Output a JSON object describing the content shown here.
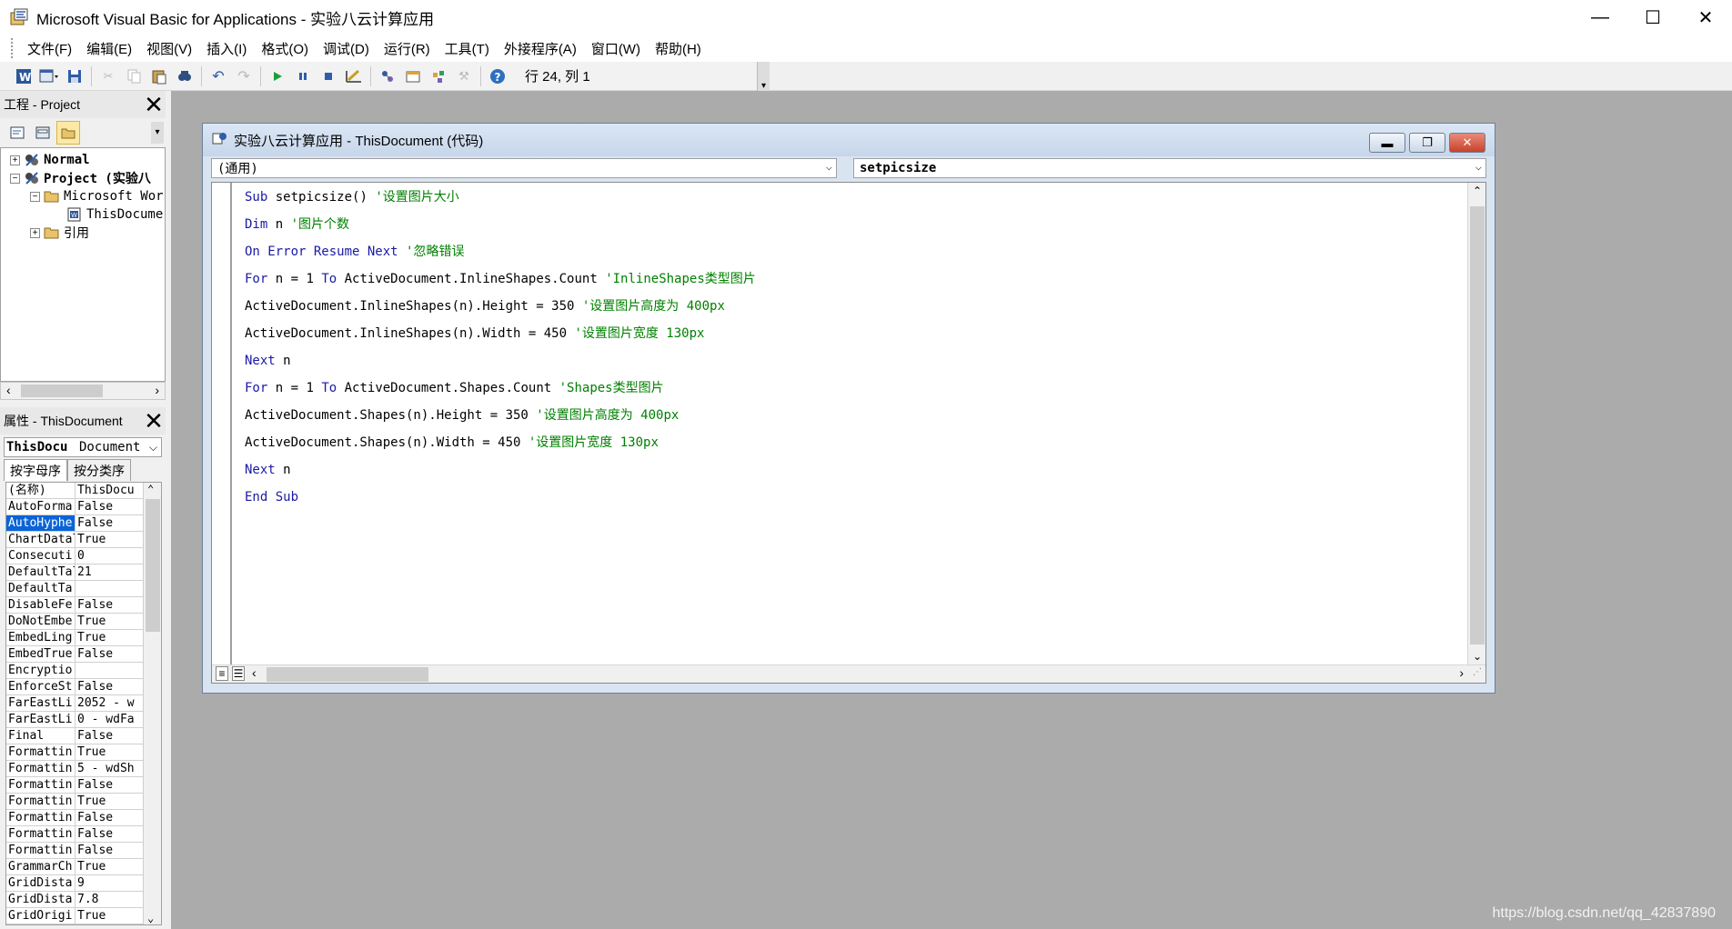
{
  "window": {
    "title": "Microsoft Visual Basic for Applications - 实验八云计算应用",
    "minimize": "—",
    "maximize": "☐",
    "close": "✕"
  },
  "menu": [
    "文件(F)",
    "编辑(E)",
    "视图(V)",
    "插入(I)",
    "格式(O)",
    "调试(D)",
    "运行(R)",
    "工具(T)",
    "外接程序(A)",
    "窗口(W)",
    "帮助(H)"
  ],
  "toolbar": {
    "position": "行 24, 列 1",
    "buttons": [
      "view-word-icon",
      "insert-userform-icon",
      "save-icon",
      "cut-icon",
      "copy-icon",
      "paste-icon",
      "find-icon",
      "undo-icon",
      "redo-icon",
      "run-icon",
      "break-icon",
      "reset-icon",
      "design-mode-icon",
      "project-explorer-icon",
      "properties-icon",
      "object-browser-icon",
      "toolbox-icon",
      "help-icon"
    ]
  },
  "project_pane": {
    "title": "工程 - Project",
    "tree": [
      {
        "label": "Normal",
        "indent": 0,
        "expander": "+",
        "icon": "vba-project-icon"
      },
      {
        "label": "Project (实验八",
        "indent": 0,
        "expander": "−",
        "icon": "vba-project-icon"
      },
      {
        "label": "Microsoft Wor",
        "indent": 1,
        "expander": "−",
        "icon": "folder-open-icon"
      },
      {
        "label": "ThisDocume",
        "indent": 2,
        "expander": "",
        "icon": "word-document-icon"
      },
      {
        "label": "引用",
        "indent": 1,
        "expander": "+",
        "icon": "folder-icon"
      }
    ]
  },
  "properties_pane": {
    "title": "属性 - ThisDocument",
    "object_name": "ThisDocu",
    "object_type": "Document",
    "tabs": [
      "按字母序",
      "按分类序"
    ],
    "rows": [
      {
        "name": "(名称)",
        "value": "ThisDocu"
      },
      {
        "name": "AutoForma",
        "value": "False"
      },
      {
        "name": "AutoHyphe",
        "value": "False"
      },
      {
        "name": "ChartDatal",
        "value": "True"
      },
      {
        "name": "Consecuti",
        "value": "0"
      },
      {
        "name": "DefaultTal",
        "value": "21"
      },
      {
        "name": "DefaultTa:",
        "value": ""
      },
      {
        "name": "DisableFe",
        "value": "False"
      },
      {
        "name": "DoNotEmbe",
        "value": "True"
      },
      {
        "name": "EmbedLing",
        "value": "True"
      },
      {
        "name": "EmbedTrue",
        "value": "False"
      },
      {
        "name": "Encryptio",
        "value": ""
      },
      {
        "name": "EnforceSt",
        "value": "False"
      },
      {
        "name": "FarEastLi",
        "value": "2052 - w"
      },
      {
        "name": "FarEastLi",
        "value": "0 - wdFa"
      },
      {
        "name": "Final",
        "value": "False"
      },
      {
        "name": "Formattin",
        "value": "True"
      },
      {
        "name": "Formattin",
        "value": "5 - wdSh"
      },
      {
        "name": "Formattin",
        "value": "False"
      },
      {
        "name": "Formattin",
        "value": "True"
      },
      {
        "name": "Formattin",
        "value": "False"
      },
      {
        "name": "Formattin",
        "value": "False"
      },
      {
        "name": "Formattin",
        "value": "False"
      },
      {
        "name": "GrammarCh",
        "value": "True"
      },
      {
        "name": "GridDista",
        "value": "9"
      },
      {
        "name": "GridDista",
        "value": "7.8"
      },
      {
        "name": "GridOrigi",
        "value": "True"
      }
    ],
    "selected_index": 2
  },
  "code_window": {
    "title": "实验八云计算应用 - ThisDocument (代码)",
    "object_combo": "(通用)",
    "procedure_combo": "setpicsize",
    "lines": [
      {
        "code": "Sub setpicsize() ",
        "comment": "'设置图片大小"
      },
      {
        "code": "Dim n ",
        "comment": "'图片个数"
      },
      {
        "code": "On Error Resume Next ",
        "comment": "'忽略错误"
      },
      {
        "code": "For n = 1 To ActiveDocument.InlineShapes.Count ",
        "comment": "'InlineShapes类型图片"
      },
      {
        "code": "ActiveDocument.InlineShapes(n).Height = 350 ",
        "comment": "'设置图片高度为 400px"
      },
      {
        "code": "ActiveDocument.InlineShapes(n).Width = 450 ",
        "comment": "'设置图片宽度 130px"
      },
      {
        "code": "Next n",
        "comment": ""
      },
      {
        "code": "For n = 1 To ActiveDocument.Shapes.Count ",
        "comment": "'Shapes类型图片"
      },
      {
        "code": "ActiveDocument.Shapes(n).Height = 350 ",
        "comment": "'设置图片高度为 400px"
      },
      {
        "code": "ActiveDocument.Shapes(n).Width = 450 ",
        "comment": "'设置图片宽度 130px"
      },
      {
        "code": "Next n",
        "comment": ""
      },
      {
        "code": "End Sub",
        "comment": ""
      }
    ]
  },
  "watermark": "https://blog.csdn.net/qq_42837890",
  "colors": {
    "keyword": "#1a1aa6",
    "comment": "#008000",
    "mdi_background": "#ababab"
  }
}
